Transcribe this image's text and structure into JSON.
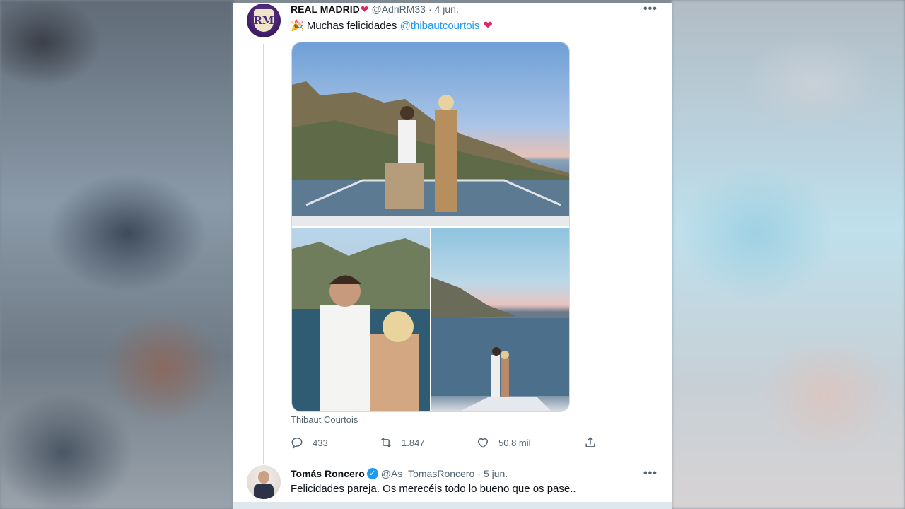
{
  "tweet": {
    "author_name": "REAL MADRID",
    "author_heart": "❤",
    "handle": "@AdriRM33",
    "separator": "·",
    "date": "4 jun.",
    "text_prefix": "🎉 Muchas felicidades ",
    "mention": "@thibautcourtois",
    "text_suffix": "❤",
    "avatar_text": "RM",
    "photo_caption": "Thibaut Courtois",
    "actions": {
      "replies": "433",
      "retweets": "1.847",
      "likes": "50,8 mil"
    }
  },
  "reply": {
    "author_name": "Tomás Roncero",
    "verified": "✓",
    "handle": "@As_TomasRoncero",
    "separator": "·",
    "date": "5 jun.",
    "text": "Felicidades pareja. Os merecéis todo lo bueno que os pase.."
  },
  "more_label": "•••",
  "colors": {
    "accent": "#1d9bf0",
    "heart": "#e0245e",
    "secondary_text": "#536471"
  }
}
